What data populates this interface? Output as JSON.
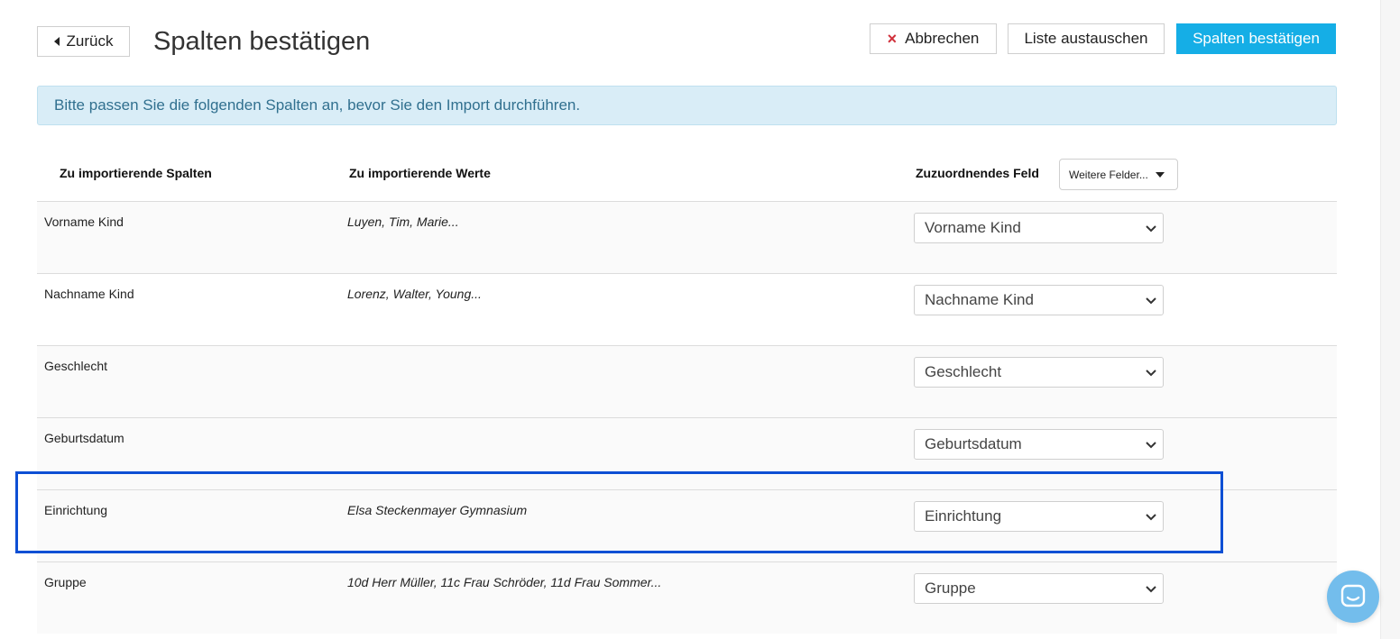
{
  "header": {
    "back_label": "Zurück",
    "title": "Spalten bestätigen",
    "cancel_icon": "×",
    "cancel_label": "Abbrechen",
    "replace_label": "Liste austauschen",
    "confirm_label": "Spalten bestätigen"
  },
  "alert": {
    "text": "Bitte passen Sie die folgenden Spalten an, bevor Sie den Import durchführen."
  },
  "table": {
    "headers": {
      "columns": "Zu importierende Spalten",
      "values": "Zu importierende Werte",
      "field": "Zuzuordnendes Feld"
    },
    "more_fields_label": "Weitere Felder...",
    "rows": [
      {
        "column": "Vorname Kind",
        "values": "Luyen, Tim, Marie...",
        "field": "Vorname Kind"
      },
      {
        "column": "Nachname Kind",
        "values": "Lorenz, Walter, Young...",
        "field": "Nachname Kind"
      },
      {
        "column": "Geschlecht",
        "values": "",
        "field": "Geschlecht"
      },
      {
        "column": "Geburtsdatum",
        "values": "",
        "field": "Geburtsdatum"
      },
      {
        "column": "Einrichtung",
        "values": "Elsa Steckenmayer Gymnasium",
        "field": "Einrichtung"
      },
      {
        "column": "Gruppe",
        "values": "10d Herr Müller, 11c Frau Schröder, 11d Frau Sommer...",
        "field": "Gruppe"
      }
    ]
  },
  "colors": {
    "primary": "#15aee6",
    "alert_bg": "#d9edf7",
    "alert_text": "#31708f",
    "cancel_icon": "#d0303b",
    "highlight": "#0d4fd4",
    "chat_bubble": "#73bdec"
  },
  "icons": {
    "back": "caret-left-icon",
    "cancel": "close-icon",
    "more_fields": "caret-down-icon",
    "select": "chevron-down-icon",
    "chat": "chat-icon"
  }
}
